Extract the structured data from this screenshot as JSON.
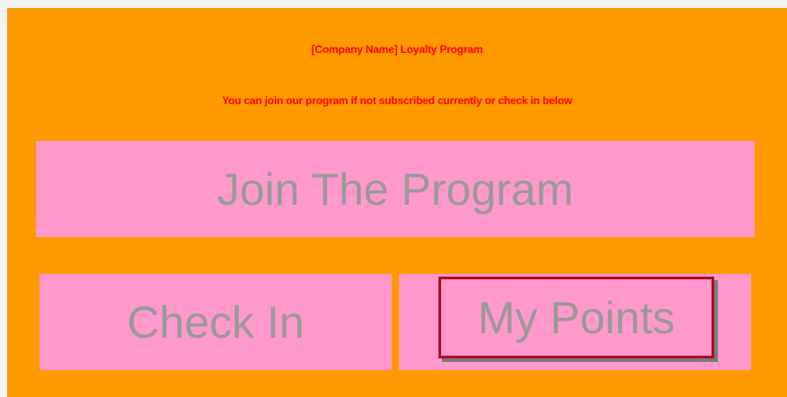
{
  "program": {
    "title": "[Company Name] Loyalty Program",
    "subtitle": "You can join our program if not subscribed currently or check in below"
  },
  "buttons": {
    "join_label": "Join The Program",
    "checkin_label": "Check In",
    "mypoints_label": "My Points"
  },
  "colors": {
    "panel_background": "#ff9900",
    "button_background": "#ff99cc",
    "button_text": "#999999",
    "heading_text": "#ff0000",
    "focus_border": "#b10d21"
  }
}
